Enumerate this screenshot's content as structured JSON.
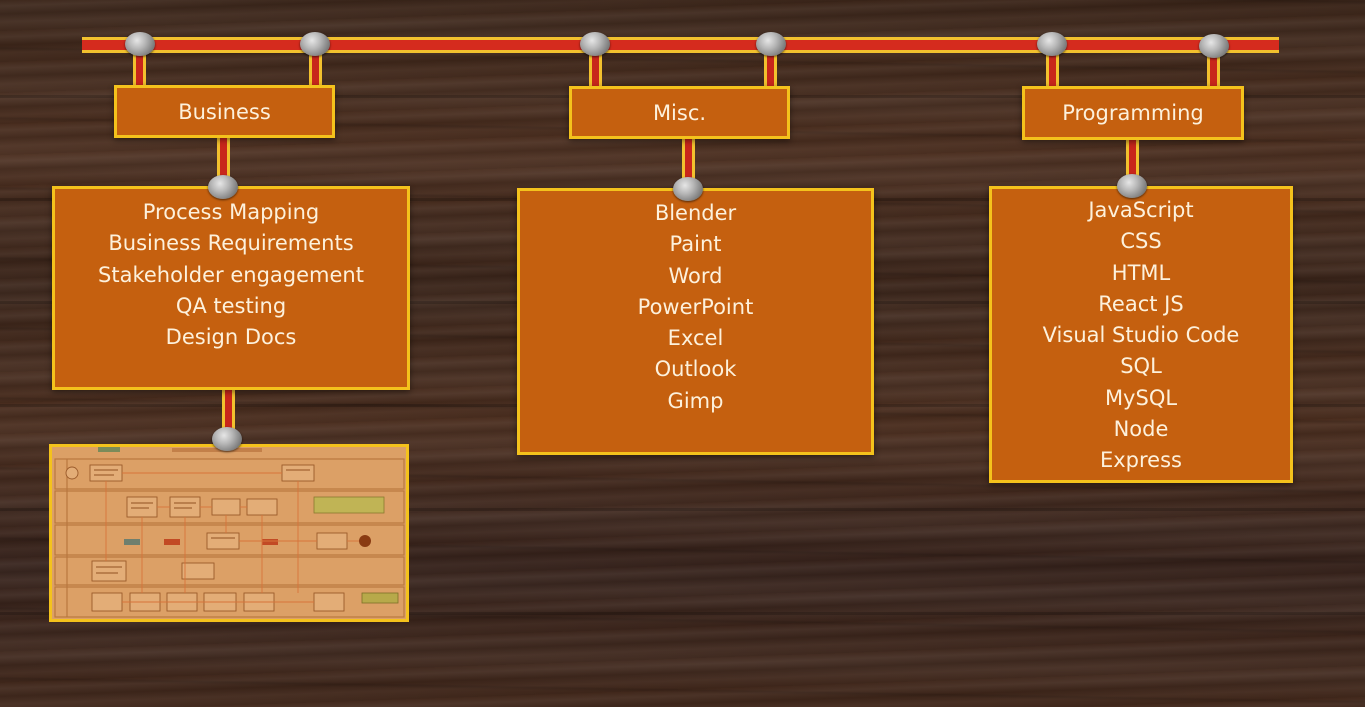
{
  "categories": {
    "business": {
      "label": "Business",
      "items": [
        "Process Mapping",
        "Business Requirements",
        "Stakeholder engagement",
        "QA testing",
        "Design Docs"
      ]
    },
    "misc": {
      "label": "Misc.",
      "items": [
        "Blender",
        "Paint",
        "Word",
        "PowerPoint",
        "Excel",
        "Outlook",
        "Gimp"
      ]
    },
    "programming": {
      "label": "Programming",
      "items": [
        "JavaScript",
        "CSS",
        "HTML",
        "React JS",
        "Visual Studio Code",
        "SQL",
        "MySQL",
        "Node",
        "Express"
      ]
    }
  },
  "colors": {
    "box_fill": "#c5600f",
    "box_border": "#f4c21c",
    "rail_red": "#d52b1e",
    "rail_yellow": "#f2c12e",
    "text": "#fdf1dc"
  },
  "thumbnail": {
    "icon": "process-flowchart-image"
  }
}
